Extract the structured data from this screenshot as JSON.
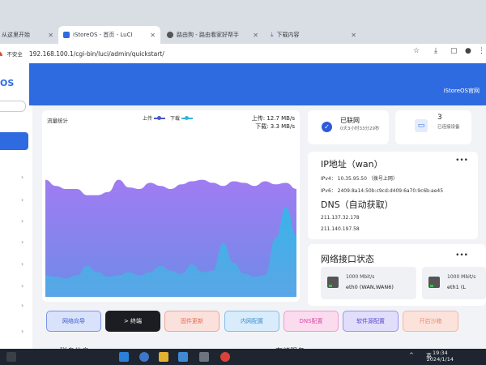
{
  "browser": {
    "tabs": [
      {
        "label": "从这里开始",
        "active": false
      },
      {
        "label": "iStoreOS - 首页 - LuCI",
        "active": true
      },
      {
        "label": "路由狗 - 路由看家好帮手",
        "active": false
      },
      {
        "label": "下载内容",
        "active": false
      }
    ],
    "security_label": "不安全",
    "url": "192.168.100.1/cgi-bin/luci/admin/quickstart/"
  },
  "header": {
    "logo_text": "OS",
    "brand": "iStoreOS官网"
  },
  "traffic": {
    "title": "流量统计",
    "legend_upload": "上传",
    "legend_download": "下载",
    "upload_rate": "上传: 12.7 MB/s",
    "download_rate": "下载: 3.3 MB/s"
  },
  "chart_data": {
    "type": "area",
    "title": "流量统计",
    "series": [
      {
        "name": "上传",
        "color": "#9b7cf0",
        "values": [
          0.76,
          0.72,
          0.7,
          0.7,
          0.66,
          0.66,
          0.68,
          0.76,
          0.71,
          0.7,
          0.74,
          0.72,
          0.7,
          0.73,
          0.75,
          0.76,
          0.74,
          0.72,
          0.75,
          0.74,
          0.72,
          0.75,
          0.73,
          0.74,
          0.7
        ]
      },
      {
        "name": "下载",
        "color": "#35b5e6",
        "values": [
          0.14,
          0.13,
          0.12,
          0.14,
          0.2,
          0.16,
          0.13,
          0.14,
          0.16,
          0.14,
          0.16,
          0.2,
          0.17,
          0.15,
          0.21,
          0.16,
          0.17,
          0.35,
          0.22,
          0.15,
          0.13,
          0.14,
          0.38,
          0.58,
          0.4
        ]
      }
    ],
    "ylim": [
      0,
      1
    ],
    "grid": false,
    "legend": "top-center"
  },
  "status": {
    "network": "已联网",
    "uptime": "0天3小时33分29秒",
    "devices_count": "3",
    "devices_label": "已连接设备"
  },
  "ip": {
    "title": "IP地址（wan）",
    "ipv4": "IPv4： 10.35.95.50 （拨号上网）",
    "ipv6": "IPv6： 2409:8a14:50b:c9cd:d409:6a70:9c6b:ae45",
    "dns_title": "DNS（自动获取）",
    "dns1": "211.137.32.178",
    "dns2": "211.140.197.58"
  },
  "interfaces": {
    "title": "网络接口状态",
    "ports": [
      {
        "speed": "1000 Mbit/s",
        "name": "eth0 (WAN,WAN6)"
      },
      {
        "speed": "1000 Mbit/s",
        "name": "eth1 (L"
      }
    ]
  },
  "quick_actions": [
    {
      "label": "网络向导",
      "bg": "#d9e2fb",
      "border": "#7a94e6",
      "color": "#3b5ccf"
    },
    {
      "label": "> 终端",
      "bg": "#1c1d22",
      "border": "#1c1d22",
      "color": "#ffffff"
    },
    {
      "label": "固件更新",
      "bg": "#fbe1dc",
      "border": "#f0a596",
      "color": "#e26a4f"
    },
    {
      "label": "内网配置",
      "bg": "#d8ecfb",
      "border": "#84bde9",
      "color": "#3d8ed3"
    },
    {
      "label": "DNS配置",
      "bg": "#fbdcef",
      "border": "#f19ad0",
      "color": "#de4aa8"
    },
    {
      "label": "软件源配置",
      "bg": "#e1defb",
      "border": "#9d93ea",
      "color": "#5a4ccc"
    },
    {
      "label": "开启沙箱",
      "bg": "#fbe3dc",
      "border": "#f4b6a2",
      "color": "#e48f72"
    }
  ],
  "sections": {
    "left": "磁盘信息",
    "right": "存储服务"
  },
  "taskbar": {
    "lang": "英",
    "time": "19:34",
    "date": "2024/1/14"
  }
}
